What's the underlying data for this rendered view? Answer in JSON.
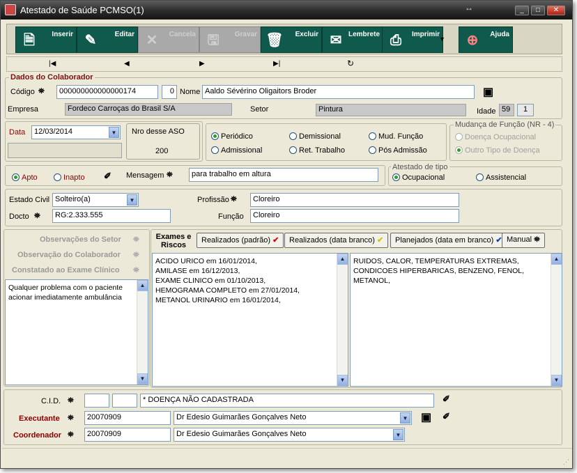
{
  "window": {
    "title": "Atestado de Saúde PCMSO(1)",
    "controls": {
      "minimize": "_",
      "maximize": "□",
      "close": "✕"
    },
    "resize_glyph": "↔"
  },
  "toolbar": {
    "buttons": [
      {
        "label": "Inserir",
        "icon": "insert-icon",
        "enabled": true
      },
      {
        "label": "Editar",
        "icon": "edit-icon",
        "enabled": true
      },
      {
        "label": "Cancela",
        "icon": "cancel-icon",
        "enabled": false
      },
      {
        "label": "Gravar",
        "icon": "save-icon",
        "enabled": false
      },
      {
        "label": "Excluir",
        "icon": "trash-icon",
        "enabled": true
      },
      {
        "label": "Lembrete",
        "icon": "note-icon",
        "enabled": true
      },
      {
        "label": "Imprimir",
        "icon": "printer-icon",
        "enabled": true
      },
      {
        "label": "Ajuda",
        "icon": "help-icon",
        "enabled": true
      }
    ],
    "print_dropdown": "▼"
  },
  "nav": {
    "first": "|◀",
    "prev": "◀",
    "next": "▶",
    "last": "▶|",
    "refresh": "↻"
  },
  "colaborador": {
    "legend": "Dados do Colaborador",
    "codigo_label": "Código",
    "codigo": "000000000000000174",
    "codigo_suffix": "0",
    "nome_label": "Nome",
    "nome": "Aaldo Sévérino Oligaitors Broder",
    "empresa_label": "Empresa",
    "empresa": "Fordeco Carroças do Brasil S/A",
    "setor_label": "Setor",
    "setor": "Pintura",
    "idade_label": "Idade",
    "idade": "59",
    "idade_extra": "1"
  },
  "data_section": {
    "data_label": "Data",
    "data": "12/03/2014",
    "nro_label": "Nro desse ASO",
    "nro": "200"
  },
  "tipo_exame": {
    "options": [
      {
        "label": "Periódico",
        "checked": true
      },
      {
        "label": "Demissional",
        "checked": false
      },
      {
        "label": "Mud. Função",
        "checked": false
      },
      {
        "label": "Admissional",
        "checked": false
      },
      {
        "label": "Ret. Trabalho",
        "checked": false
      },
      {
        "label": "Pós Admissão",
        "checked": false
      }
    ]
  },
  "mudanca": {
    "legend": "Mudança de Função (NR - 4)",
    "options": [
      {
        "label": "Doença Ocupacional",
        "checked": false
      },
      {
        "label": "Outro Tipo de Doença",
        "checked": true
      }
    ]
  },
  "aptidao": {
    "apto": "Apto",
    "inapto": "Inapto",
    "apto_checked": true,
    "mensagem_label": "Mensagem",
    "mensagem": "para trabalho em altura"
  },
  "atestado_tipo": {
    "legend": "Atestado de tipo",
    "ocupacional": "Ocupacional",
    "assistencial": "Assistencial",
    "ocupacional_checked": true
  },
  "pessoal": {
    "estado_civil_label": "Estado Civil",
    "estado_civil": "Solteiro(a)",
    "docto_label": "Docto",
    "docto": "RG:2.333.555",
    "profissao_label": "Profissão",
    "profissao": "Cloreiro",
    "funcao_label": "Função",
    "funcao": "Cloreiro"
  },
  "observacoes": {
    "setor": "Observações do Setor",
    "colaborador": "Observação do Colaborador",
    "constatado": "Constatado ao Exame Clínico",
    "texto": "Qualquer problema com o paciente acionar imediatamente ambulância"
  },
  "exames": {
    "title": "Exames e Riscos",
    "btn_realizados": "Realizados (padrão)",
    "btn_realizados_branco": "Realizados (data branco)",
    "btn_planejados": "Planejados (data em branco)",
    "btn_manual": "Manual",
    "lista": [
      "ACIDO URICO em 16/01/2014,",
      "AMILASE em 16/12/2013,",
      "EXAME CLINICO em 01/10/2013,",
      "HEMOGRAMA COMPLETO em 27/01/2014,",
      "METANOL URINARIO em 16/01/2014,"
    ],
    "riscos": "RUIDOS, CALOR, TEMPERATURAS EXTREMAS, CONDICOES HIPERBARICAS, BENZENO, FENOL, METANOL,"
  },
  "rodape": {
    "cid_label": "C.I.D.",
    "cid_texto": "* DOENÇA NÃO CADASTRADA",
    "executante_label": "Executante",
    "executante_codigo": "20070909",
    "executante_nome": "Dr Edesio Guimarães Gonçalves Neto",
    "coordenador_label": "Coordenador",
    "coordenador_codigo": "20070909",
    "coordenador_nome": "Dr Edesio Guimarães Gonçalves Neto"
  },
  "colors": {
    "toolbar_button": "#0f5a4c",
    "label_red": "#8a0000",
    "window_bg": "#ece9d8"
  }
}
